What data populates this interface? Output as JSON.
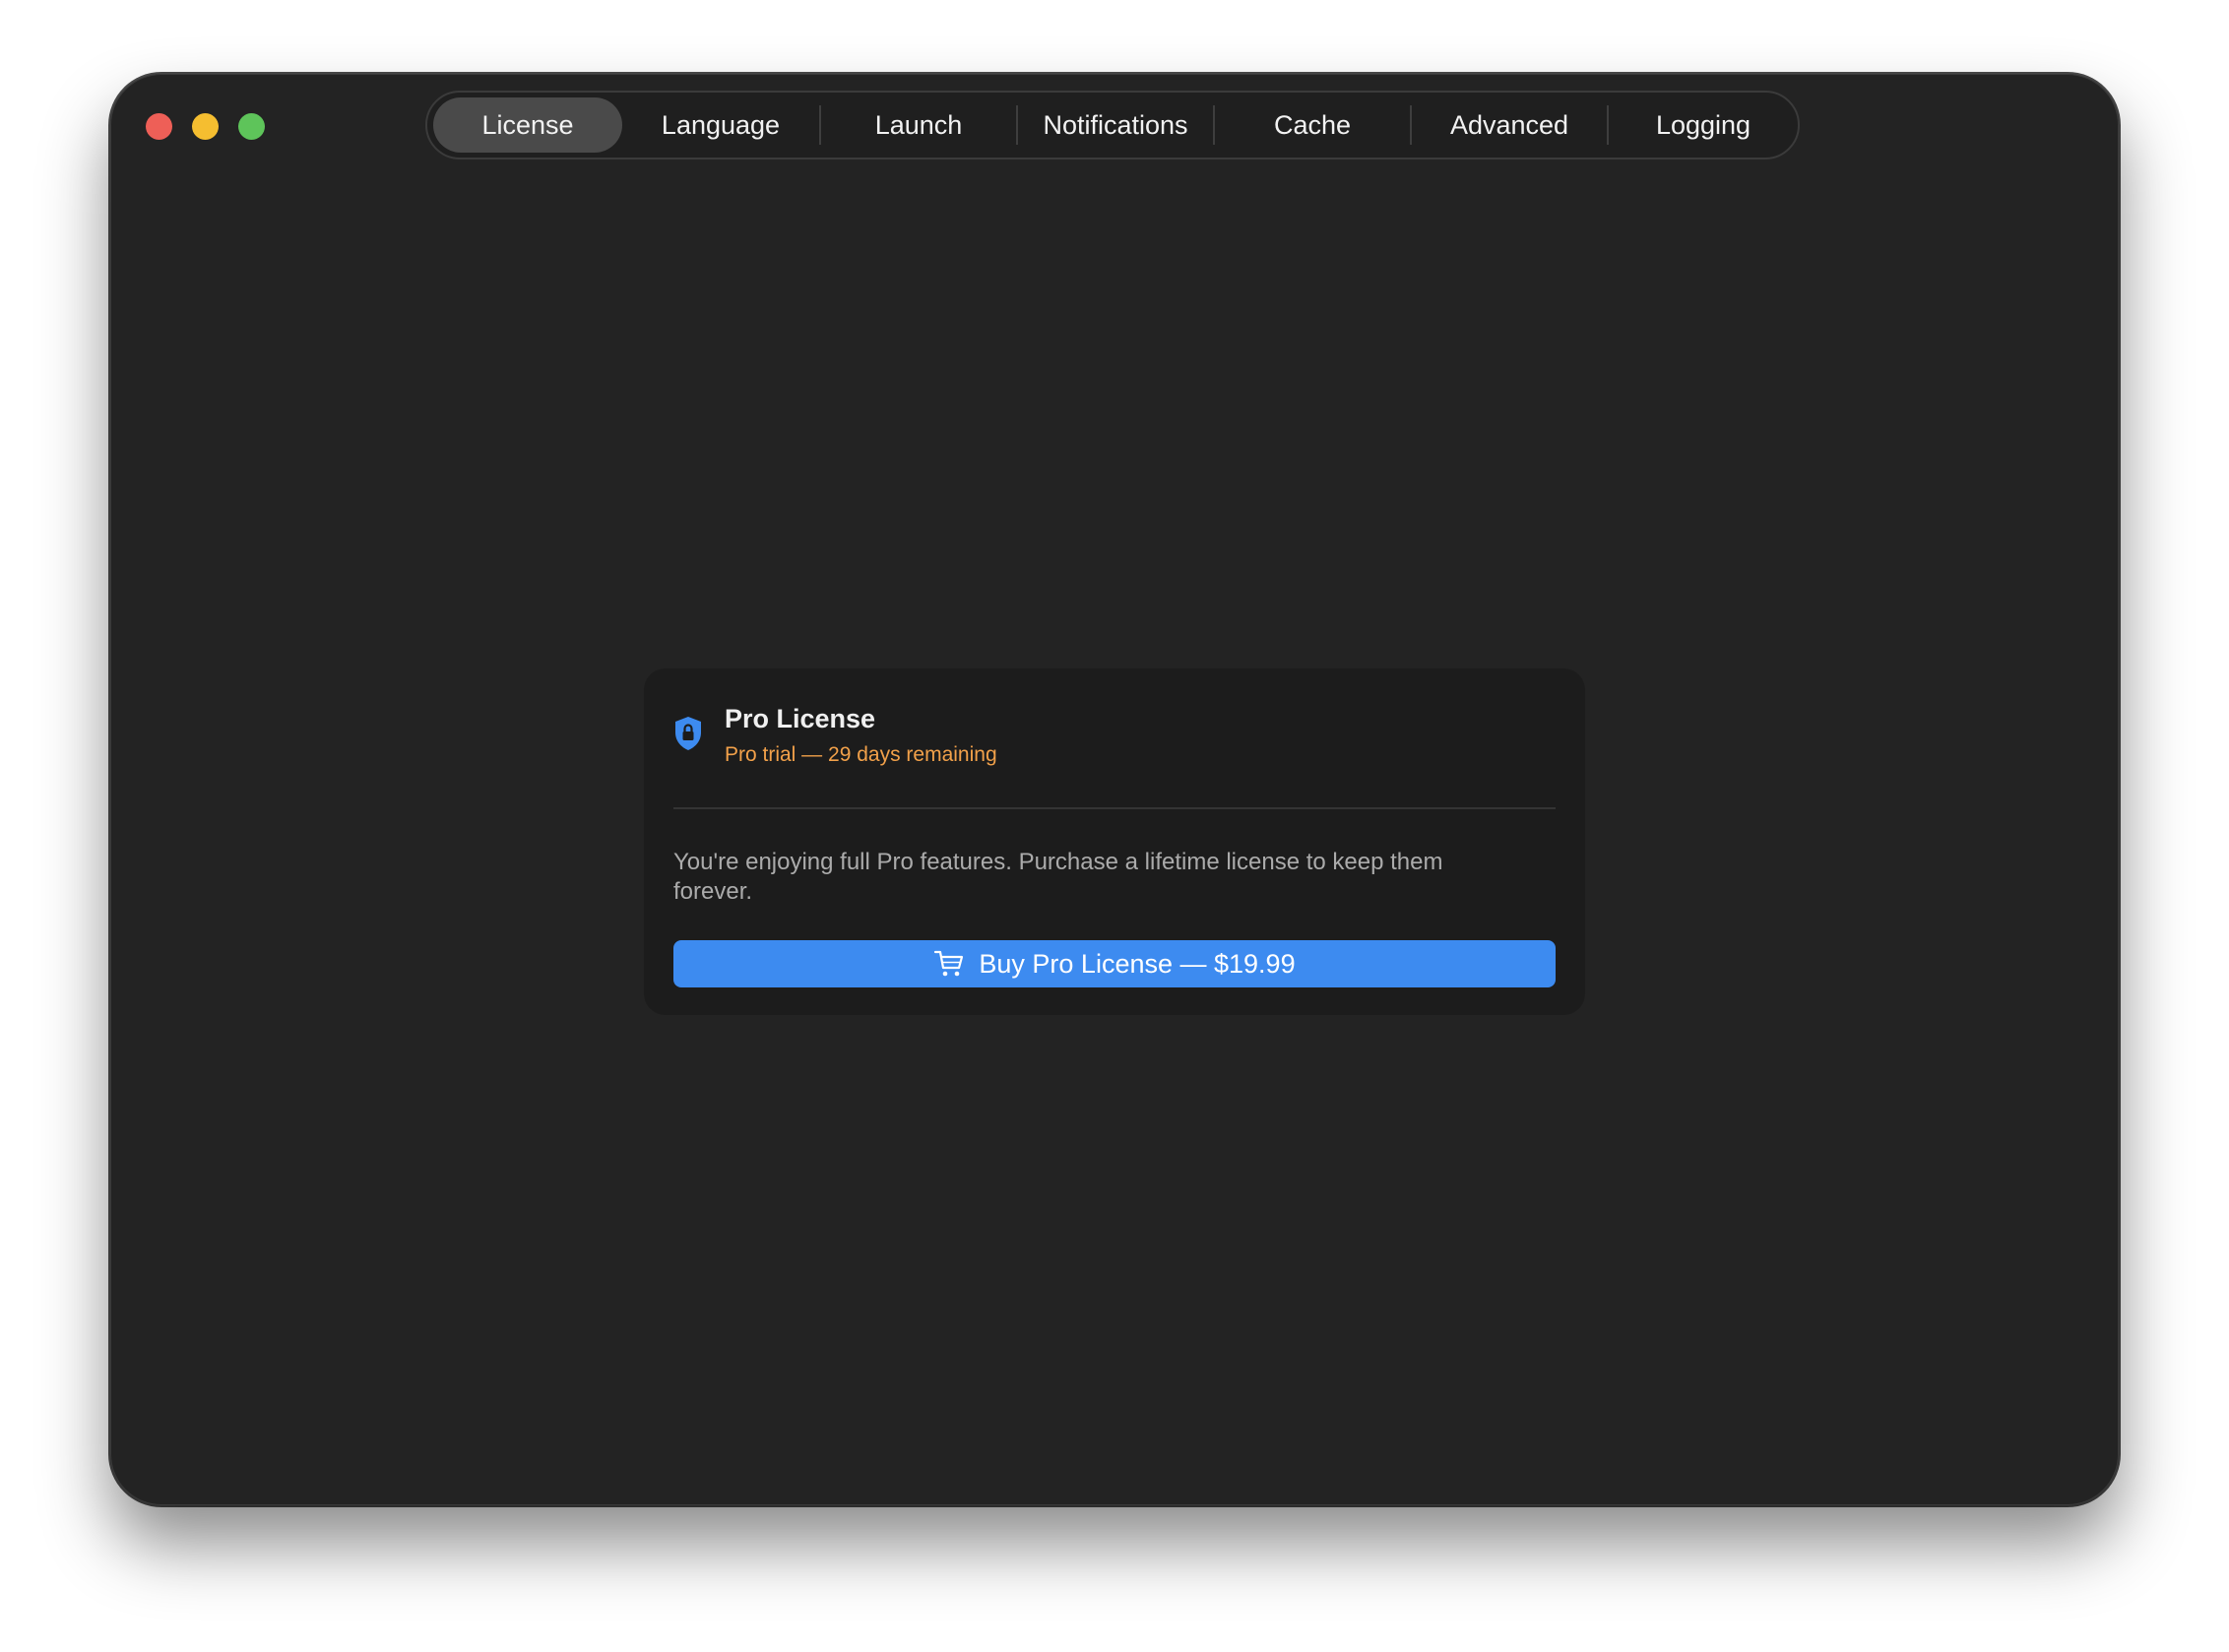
{
  "window": {
    "traffic_lights": [
      "close",
      "minimize",
      "zoom"
    ],
    "colors": {
      "close": "#ee5f57",
      "minimize": "#f5be30",
      "zoom": "#5ec45a"
    }
  },
  "tabs": {
    "items": [
      {
        "label": "License",
        "active": true
      },
      {
        "label": "Language",
        "active": false
      },
      {
        "label": "Launch",
        "active": false
      },
      {
        "label": "Notifications",
        "active": false
      },
      {
        "label": "Cache",
        "active": false
      },
      {
        "label": "Advanced",
        "active": false
      },
      {
        "label": "Logging",
        "active": false
      }
    ]
  },
  "license_card": {
    "icon": "shield-lock-icon",
    "title": "Pro License",
    "status": "Pro trial — 29 days remaining",
    "description": "You're enjoying full Pro features. Purchase a lifetime license to keep them forever.",
    "buy_button": {
      "icon": "cart-icon",
      "label": "Buy Pro License — $19.99"
    },
    "colors": {
      "accent": "#3d8bf0",
      "status": "#f2a14a"
    }
  }
}
